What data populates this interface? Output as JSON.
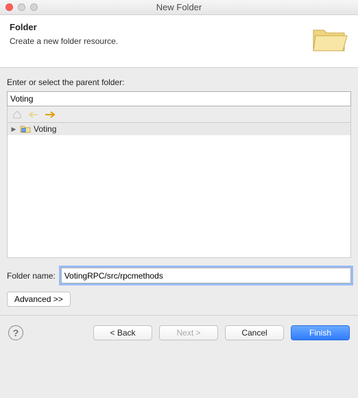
{
  "window": {
    "title": "New Folder"
  },
  "header": {
    "title": "Folder",
    "subtitle": "Create a new folder resource."
  },
  "parent": {
    "label": "Enter or select the parent folder:",
    "value": "Voting",
    "tree": {
      "items": [
        {
          "label": "Voting"
        }
      ]
    }
  },
  "folder_name": {
    "label": "Folder name:",
    "value": "VotingRPC/src/rpcmethods"
  },
  "advanced": {
    "label": "Advanced >>"
  },
  "buttons": {
    "back": "< Back",
    "next": "Next >",
    "cancel": "Cancel",
    "finish": "Finish"
  }
}
